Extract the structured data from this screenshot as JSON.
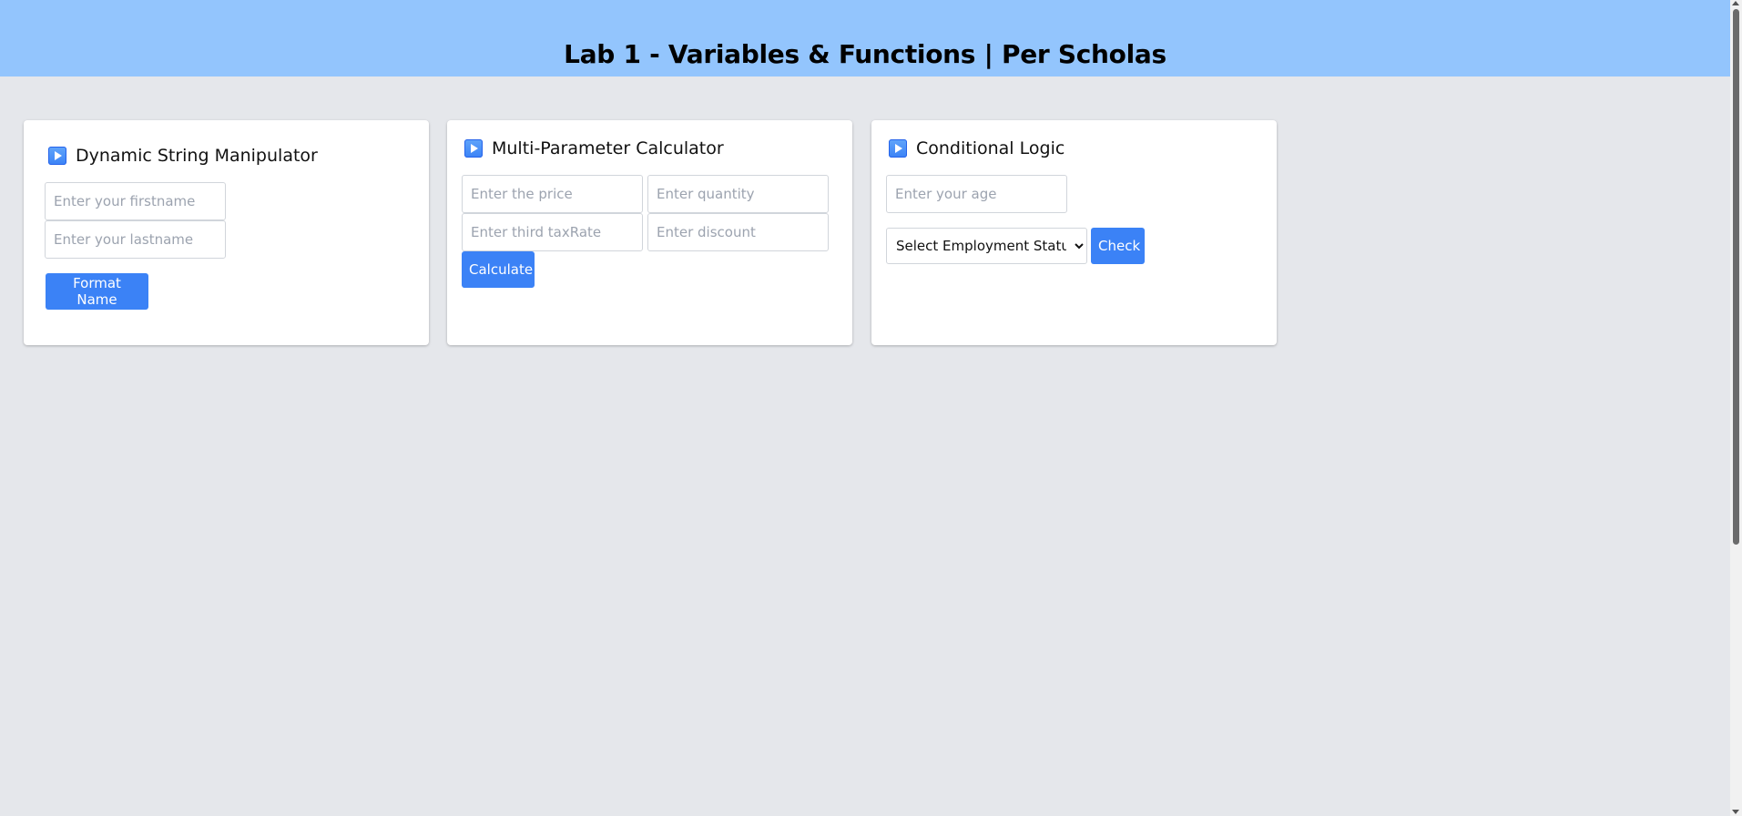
{
  "header": {
    "title": "Lab 1 - Variables & Functions | Per Scholas",
    "background_color": "#93c5fd"
  },
  "cards": {
    "string_manipulator": {
      "title": "Dynamic String Manipulator",
      "icon": "play-button-icon",
      "firstname_placeholder": "Enter your firstname",
      "lastname_placeholder": "Enter your lastname",
      "button_label": "Format Name"
    },
    "calculator": {
      "title": "Multi-Parameter Calculator",
      "icon": "play-button-icon",
      "price_placeholder": "Enter the price",
      "quantity_placeholder": "Enter quantity",
      "taxrate_placeholder": "Enter third taxRate",
      "discount_placeholder": "Enter discount",
      "button_label": "Calculate"
    },
    "conditional": {
      "title": "Conditional Logic",
      "icon": "play-button-icon",
      "age_placeholder": "Enter your age",
      "employment_selected": "Select Employment Status",
      "button_label": "Check"
    }
  },
  "colors": {
    "page_background": "#e5e7eb",
    "button": "#3b82f6",
    "card_background": "#ffffff"
  }
}
